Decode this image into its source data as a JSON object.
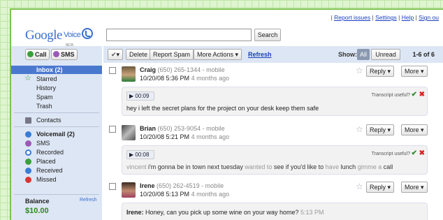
{
  "header": {
    "links": [
      "Report issues",
      "Settings",
      "Help",
      "Sign ou"
    ],
    "logo_google": "Google",
    "logo_voice": "Voice",
    "logo_beta": "BETA",
    "search_button": "Search"
  },
  "actions": {
    "call": "Call",
    "sms": "SMS"
  },
  "toolbar": {
    "select": "▾",
    "delete": "Delete",
    "report_spam": "Report Spam",
    "more_actions": "More Actions ▾",
    "refresh": "Refresh",
    "show": "Show:",
    "all": "All",
    "unread": "Unread",
    "count": "1-6 of 6"
  },
  "sidebar": {
    "inbox": "Inbox (2)",
    "starred": "Starred",
    "history": "History",
    "spam": "Spam",
    "trash": "Trash",
    "contacts": "Contacts",
    "voicemail": "Voicemail (2)",
    "sms": "SMS",
    "recorded": "Recorded",
    "placed": "Placed",
    "received": "Received",
    "missed": "Missed",
    "balance_label": "Balance",
    "balance_value": "$10.00",
    "balance_refresh": "Refresh"
  },
  "messages": [
    {
      "name": "Craig",
      "phone": "(650) 265-1344",
      "type": "- mobile",
      "date": "10/20/08 5:36 PM",
      "ago": "4 months ago",
      "play": "00:09",
      "transcript_q": "Transcript useful?",
      "t1": "hey i left the secret plans for the project on your desk keep them safe"
    },
    {
      "name": "Brian",
      "phone": "(650) 253-9054",
      "type": "- mobile",
      "date": "10/20/08 5:21 PM",
      "ago": "4 months ago",
      "play": "00:08",
      "transcript_q": "Transcript useful?",
      "t1": "vincent",
      "t2": " i'm gonna be in town next tuesday ",
      "t3": "wanted to ",
      "t4": "see if you'd like to ",
      "t5": "have ",
      "t6": "lunch ",
      "t7": "gimme a ",
      "t8": "call"
    },
    {
      "name": "Irene",
      "phone": "(650) 262-4519",
      "type": "- mobile",
      "date": "10/20/08 5:13 PM",
      "ago": "4 months ago",
      "sms_from": "Irene:",
      "sms_text": " Honey, can you pick up some wine on your way home?",
      "sms_time": " 5:13 PM"
    }
  ],
  "buttons": {
    "reply": "Reply ▾",
    "more": "More ▾"
  },
  "colors": {
    "accent": "#4a78cf",
    "panel": "#dde6f4"
  }
}
